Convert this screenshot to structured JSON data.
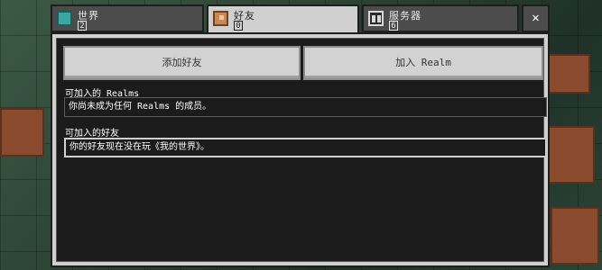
{
  "tabs": [
    {
      "label": "世界",
      "count": "2",
      "icon": "globe-icon"
    },
    {
      "label": "好友",
      "count": "0",
      "icon": "friends-icon"
    },
    {
      "label": "服务器",
      "count": "6",
      "icon": "server-icon"
    }
  ],
  "close_label": "✕",
  "buttons": {
    "add_friend": "添加好友",
    "join_realm": "加入 Realm"
  },
  "sections": {
    "realms_title": "可加入的 Realms",
    "realms_message": "你尚未成为任何 Realms 的成员。",
    "friends_title": "可加入的好友",
    "friends_message": "你的好友现在没在玩《我的世界》。"
  },
  "colors": {
    "panel": "#d0d0d0",
    "inner": "#1b1b1b",
    "tab_inactive": "#4c4c4c"
  }
}
